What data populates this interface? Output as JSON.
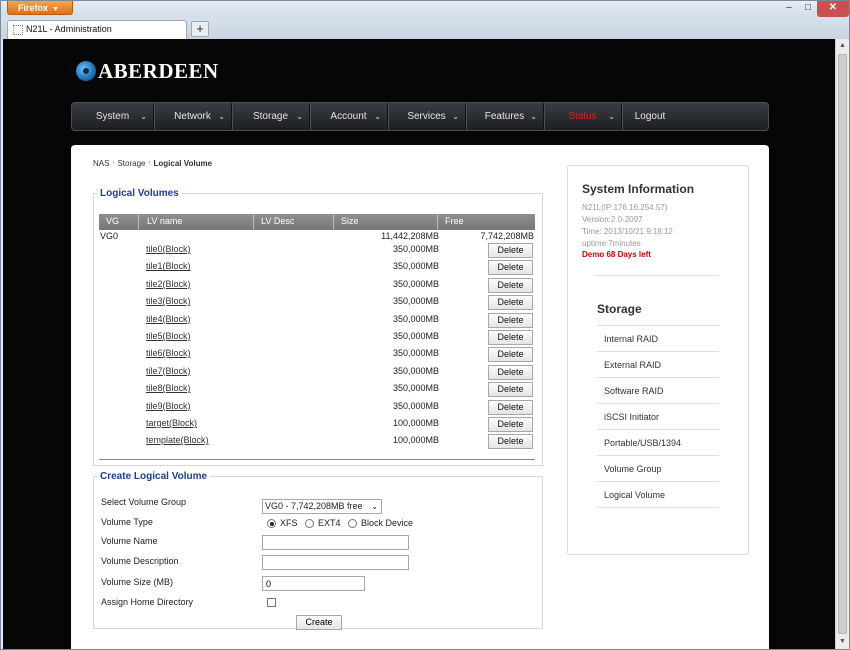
{
  "browser": {
    "menu_label": "Firefox",
    "tab_title": "N21L - Administration",
    "new_tab": "+",
    "minimize": "–",
    "maximize": "□",
    "close": "✕"
  },
  "brand": {
    "name": "ABERDEEN"
  },
  "nav": [
    {
      "label": "System"
    },
    {
      "label": "Network"
    },
    {
      "label": "Storage"
    },
    {
      "label": "Account"
    },
    {
      "label": "Services"
    },
    {
      "label": "Features"
    },
    {
      "label": "Status"
    },
    {
      "label": "Logout"
    }
  ],
  "nav_active_color": "#e02020",
  "breadcrumb": {
    "items": [
      "NAS",
      "Storage",
      "Logical Volume"
    ]
  },
  "logical_volumes": {
    "legend": "Logical Volumes",
    "columns": [
      "VG",
      "LV name",
      "LV Desc",
      "Size",
      "Free"
    ],
    "vg": {
      "name": "VG0",
      "size": "11,442,208MB",
      "free": "7,742,208MB"
    },
    "volumes": [
      {
        "name": "tile0(Block)",
        "size": "350,000MB"
      },
      {
        "name": "tile1(Block)",
        "size": "350,000MB"
      },
      {
        "name": "tile2(Block)",
        "size": "350,000MB"
      },
      {
        "name": "tile3(Block)",
        "size": "350,000MB"
      },
      {
        "name": "tile4(Block)",
        "size": "350,000MB"
      },
      {
        "name": "tile5(Block)",
        "size": "350,000MB"
      },
      {
        "name": "tile6(Block)",
        "size": "350,000MB"
      },
      {
        "name": "tile7(Block)",
        "size": "350,000MB"
      },
      {
        "name": "tile8(Block)",
        "size": "350,000MB"
      },
      {
        "name": "tile9(Block)",
        "size": "350,000MB"
      },
      {
        "name": "target(Block)",
        "size": "100,000MB"
      },
      {
        "name": "template(Block)",
        "size": "100,000MB"
      }
    ],
    "delete_label": "Delete"
  },
  "create": {
    "legend": "Create Logical Volume",
    "select_vg_label": "Select Volume Group",
    "select_vg_value": "VG0 - 7,742,208MB free",
    "volume_type_label": "Volume Type",
    "types": [
      "XFS",
      "EXT4",
      "Block Device"
    ],
    "volume_name_label": "Volume Name",
    "volume_name_value": "",
    "volume_desc_label": "Volume Description",
    "volume_desc_value": "",
    "volume_size_label": "Volume Size (MB)",
    "volume_size_value": "0",
    "assign_home_label": "Assign Home Directory",
    "create_label": "Create"
  },
  "system_info": {
    "title": "System Information",
    "host": "N21L(IP:176.16.254.57)",
    "version": "Version:2.0-2097",
    "time": "Time: 2013/10/21 9:18:12",
    "uptime": "uptime:7minutes",
    "demo": "Demo 68 Days left"
  },
  "storage_menu": {
    "title": "Storage",
    "items": [
      "Internal RAID",
      "External RAID",
      "Software RAID",
      "iSCSI Initiator",
      "Portable/USB/1394",
      "Volume Group",
      "Logical Volume"
    ]
  }
}
